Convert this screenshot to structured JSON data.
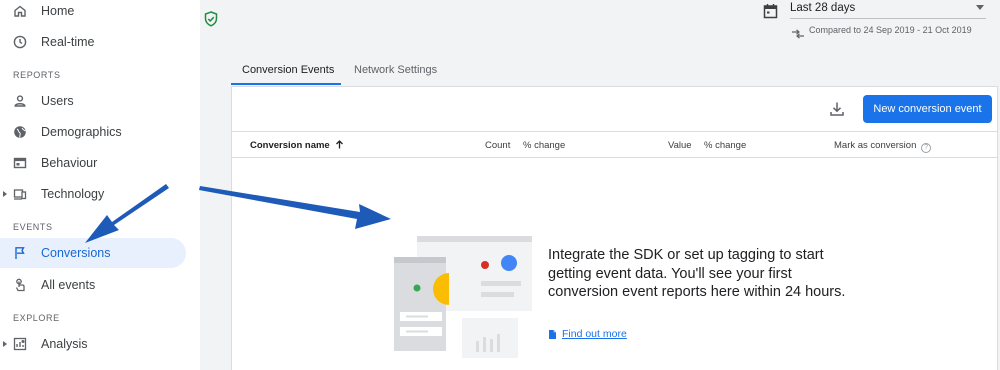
{
  "sidebar": {
    "items_top": [
      {
        "label": "Home",
        "icon": "home-icon"
      },
      {
        "label": "Real-time",
        "icon": "clock-icon"
      }
    ],
    "sections": {
      "reports": "REPORTS",
      "events": "EVENTS",
      "explore": "EXPLORE"
    },
    "reports_items": [
      {
        "label": "Users",
        "icon": "person-icon"
      },
      {
        "label": "Demographics",
        "icon": "globe-icon"
      },
      {
        "label": "Behaviour",
        "icon": "window-icon"
      },
      {
        "label": "Technology",
        "icon": "devices-icon"
      }
    ],
    "events_items": [
      {
        "label": "Conversions",
        "icon": "flag-icon",
        "active": true
      },
      {
        "label": "All events",
        "icon": "touch-icon"
      }
    ],
    "explore_items": [
      {
        "label": "Analysis",
        "icon": "analysis-icon"
      }
    ]
  },
  "header": {
    "date_range": "Last 28 days",
    "compare_text": "Compared to 24 Sep 2019 - 21 Oct 2019"
  },
  "tabs": [
    {
      "label": "Conversion Events",
      "active": true
    },
    {
      "label": "Network Settings",
      "active": false
    }
  ],
  "toolbar": {
    "new_button": "New conversion event"
  },
  "table": {
    "columns": [
      "Conversion name",
      "Count",
      "% change",
      "Value",
      "% change",
      "Mark as conversion"
    ],
    "help_glyph": "?"
  },
  "empty_state": {
    "message": "Integrate the SDK or set up tagging to start getting event data. You'll see your first conversion event reports here within 24 hours.",
    "link": "Find out more"
  },
  "colors": {
    "accent": "#1a73e8",
    "active_nav_bg": "#e8f0fe",
    "annotation_arrow": "#1e5bb8",
    "shield": "#1e8e3e"
  }
}
